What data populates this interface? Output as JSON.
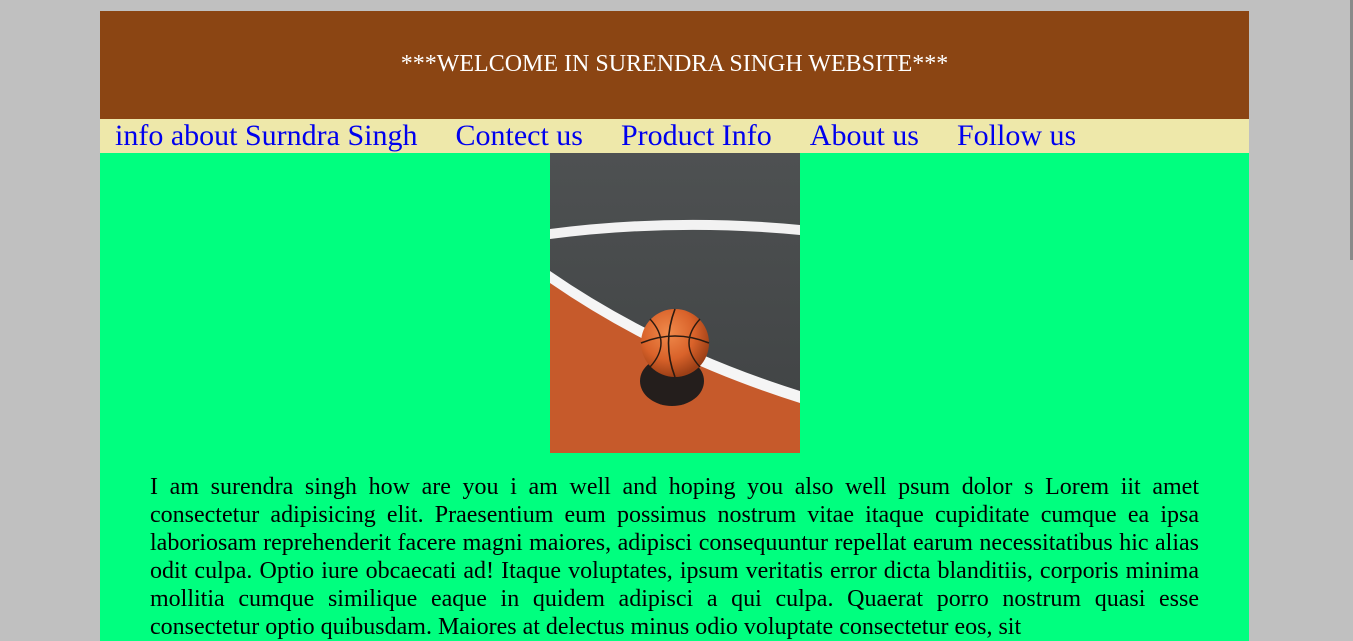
{
  "header": {
    "title": "***WELCOME IN SURENDRA SINGH WEBSITE***"
  },
  "nav": {
    "items": [
      {
        "label": "info about Surndra Singh"
      },
      {
        "label": "Contect us"
      },
      {
        "label": "Product Info"
      },
      {
        "label": "About us"
      },
      {
        "label": "Follow us"
      }
    ]
  },
  "main": {
    "image_icon": "basketball-court-photo",
    "paragraph": "I am surendra singh how are you i am well and hoping you also well psum dolor s Lorem iit amet consectetur adipisicing elit. Praesentium eum possimus nostrum vitae itaque cupiditate cumque ea ipsa laboriosam reprehenderit facere magni maiores, adipisci consequuntur repellat earum necessitatibus hic alias odit culpa. Optio iure obcaecati ad! Itaque voluptates, ipsum veritatis error dicta blanditiis, corporis minima mollitia cumque similique eaque in quidem adipisci a qui culpa. Quaerat porro nostrum quasi esse consectetur optio quibusdam. Maiores at delectus minus odio voluptate consectetur eos, sit"
  },
  "colors": {
    "header_bg": "#8b4513",
    "nav_bg": "#eee8aa",
    "content_bg": "#00ff7f",
    "page_bg": "#c0c0c0",
    "link": "#0000ee"
  }
}
